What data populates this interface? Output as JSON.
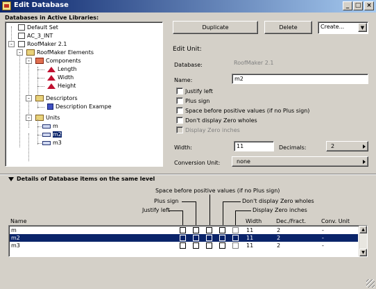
{
  "window": {
    "title": "Edit Database",
    "minimize": "_",
    "maximize": "□",
    "close": "×"
  },
  "tree": {
    "heading": "Databases in Active Libraries:",
    "nodes": {
      "default_set": "Default Set",
      "ac3": "AC_3_INT",
      "roofmaker": "RoofMaker 2.1",
      "elements": "RoofMaker Elements",
      "components": "Components",
      "length": "Length",
      "width": "Width",
      "height": "Height",
      "descriptors": "Descriptors",
      "desc_example": "Description Exampe",
      "units": "Units",
      "m": "m",
      "m2": "m2",
      "m3": "m3"
    }
  },
  "toolbar": {
    "duplicate": "Duplicate",
    "delete": "Delete",
    "create": "Create..."
  },
  "edit_unit": {
    "heading": "Edit Unit:",
    "database_label": "Database:",
    "database_value": "RoofMaker 2.1",
    "name_label": "Name:",
    "name_value": "m2",
    "checks": {
      "justify_left": "Justify left",
      "plus_sign": "Plus sign",
      "space_before": "Space before positive values (if no Plus sign)",
      "no_zero_wholes": "Don't display Zero wholes",
      "zero_inches": "Display Zero inches"
    },
    "width_label": "Width:",
    "width_value": "11",
    "decimals_label": "Decimals:",
    "decimals_value": "2",
    "conversion_label": "Conversion Unit:",
    "conversion_value": "none"
  },
  "details": {
    "heading": "Details of Database items on the same level",
    "guides": {
      "space_before": "Space before positive values (if no Plus sign)",
      "plus_sign": "Plus sign",
      "no_zero_wholes": "Don't display Zero wholes",
      "justify_left": "Justify left",
      "zero_inches": "Display Zero inches"
    },
    "columns": {
      "name": "Name",
      "width": "Width",
      "dec": "Dec./Fract.",
      "conv": "Conv. Unit"
    },
    "rows": [
      {
        "name": "m",
        "width": "11",
        "dec": "2",
        "conv": "-"
      },
      {
        "name": "m2",
        "width": "11",
        "dec": "2",
        "conv": "-"
      },
      {
        "name": "m3",
        "width": "11",
        "dec": "2",
        "conv": "-"
      }
    ]
  }
}
